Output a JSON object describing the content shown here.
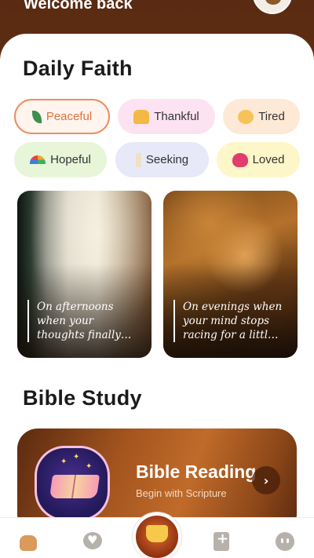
{
  "header": {
    "welcome": "Welcome back"
  },
  "daily_faith": {
    "title": "Daily Faith",
    "moods": [
      {
        "label": "Peaceful",
        "icon": "leaf-icon",
        "selected": true
      },
      {
        "label": "Thankful",
        "icon": "folded-hands-icon",
        "selected": false
      },
      {
        "label": "Tired",
        "icon": "tired-face-icon",
        "selected": false
      },
      {
        "label": "Hopeful",
        "icon": "rainbow-icon",
        "selected": false
      },
      {
        "label": "Seeking",
        "icon": "candle-icon",
        "selected": false
      },
      {
        "label": "Loved",
        "icon": "heart-icon",
        "selected": false
      }
    ],
    "cards": [
      {
        "quote": "On afternoons\nwhen your\nthoughts finally…"
      },
      {
        "quote": "On evenings when\nyour mind stops\nracing for a littl…"
      }
    ]
  },
  "bible_study": {
    "title": "Bible Study",
    "card": {
      "title": "Bible Reading",
      "subtitle": "Begin with Scripture",
      "arrow": "›"
    }
  },
  "nav": {
    "items": [
      "home-icon",
      "heart-icon",
      "crown-icon",
      "bible-icon",
      "profile-icon"
    ]
  },
  "colors": {
    "accent": "#f08a5d",
    "brown": "#7a3d1a"
  }
}
